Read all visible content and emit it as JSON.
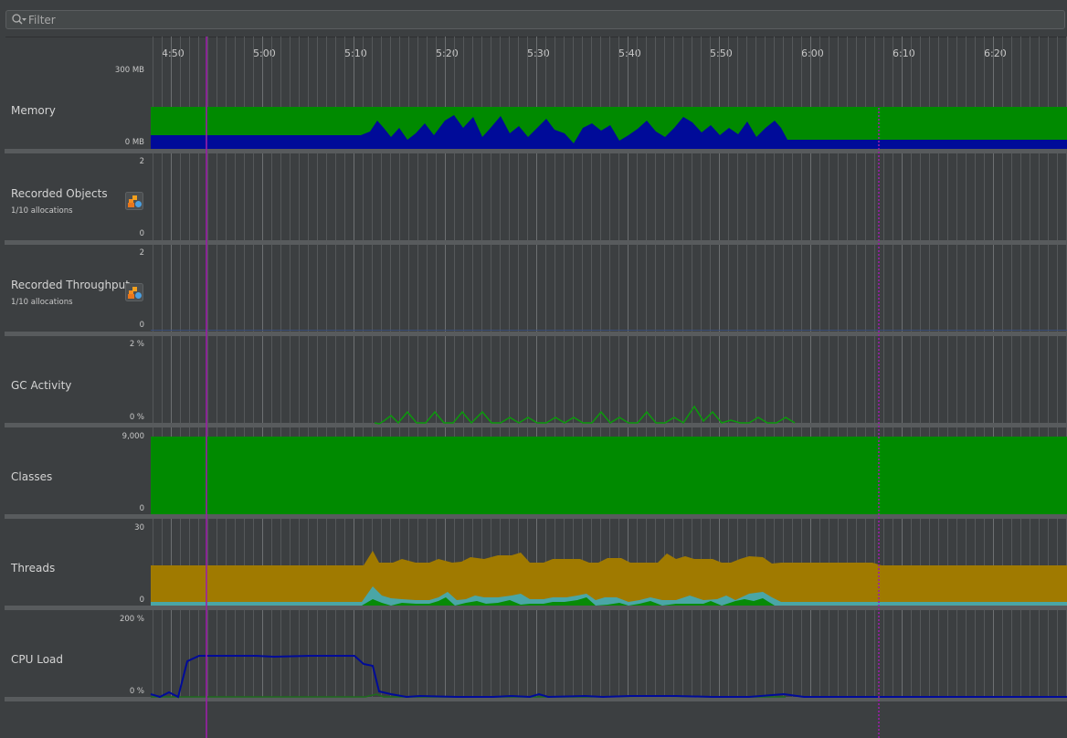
{
  "filter": {
    "placeholder": "Filter",
    "value": ""
  },
  "timeline": {
    "ticks": [
      "4:50",
      "5:00",
      "5:10",
      "5:20",
      "5:30",
      "5:40",
      "5:50",
      "6:00",
      "6:10",
      "6:20"
    ]
  },
  "colors": {
    "green": "#008a00",
    "navy": "#000b99",
    "gold": "#a07a00",
    "teal": "#4aa6a6",
    "cursor_solid": "#9c1fa8",
    "cursor_dotted": "#9c1fa8",
    "track_bg": "#3c3f41"
  },
  "tracks": [
    {
      "id": "memory",
      "title": "Memory",
      "sub": "",
      "max": "300 MB",
      "min": "0 MB"
    },
    {
      "id": "recorded-objects",
      "title": "Recorded Objects",
      "sub": "1/10 allocations",
      "max": "2",
      "min": "0",
      "action_icon": "allocation-recording-icon"
    },
    {
      "id": "recorded-throughput",
      "title": "Recorded Throughput",
      "sub": "1/10 allocations",
      "max": "2",
      "min": "0",
      "action_icon": "allocation-recording-icon"
    },
    {
      "id": "gc-activity",
      "title": "GC Activity",
      "sub": "",
      "max": "2 %",
      "min": "0 %"
    },
    {
      "id": "classes",
      "title": "Classes",
      "sub": "",
      "max": "9,000",
      "min": "0"
    },
    {
      "id": "threads",
      "title": "Threads",
      "sub": "",
      "max": "30",
      "min": "0"
    },
    {
      "id": "cpu-load",
      "title": "CPU Load",
      "sub": "",
      "max": "200 %",
      "min": "0 %"
    }
  ]
}
